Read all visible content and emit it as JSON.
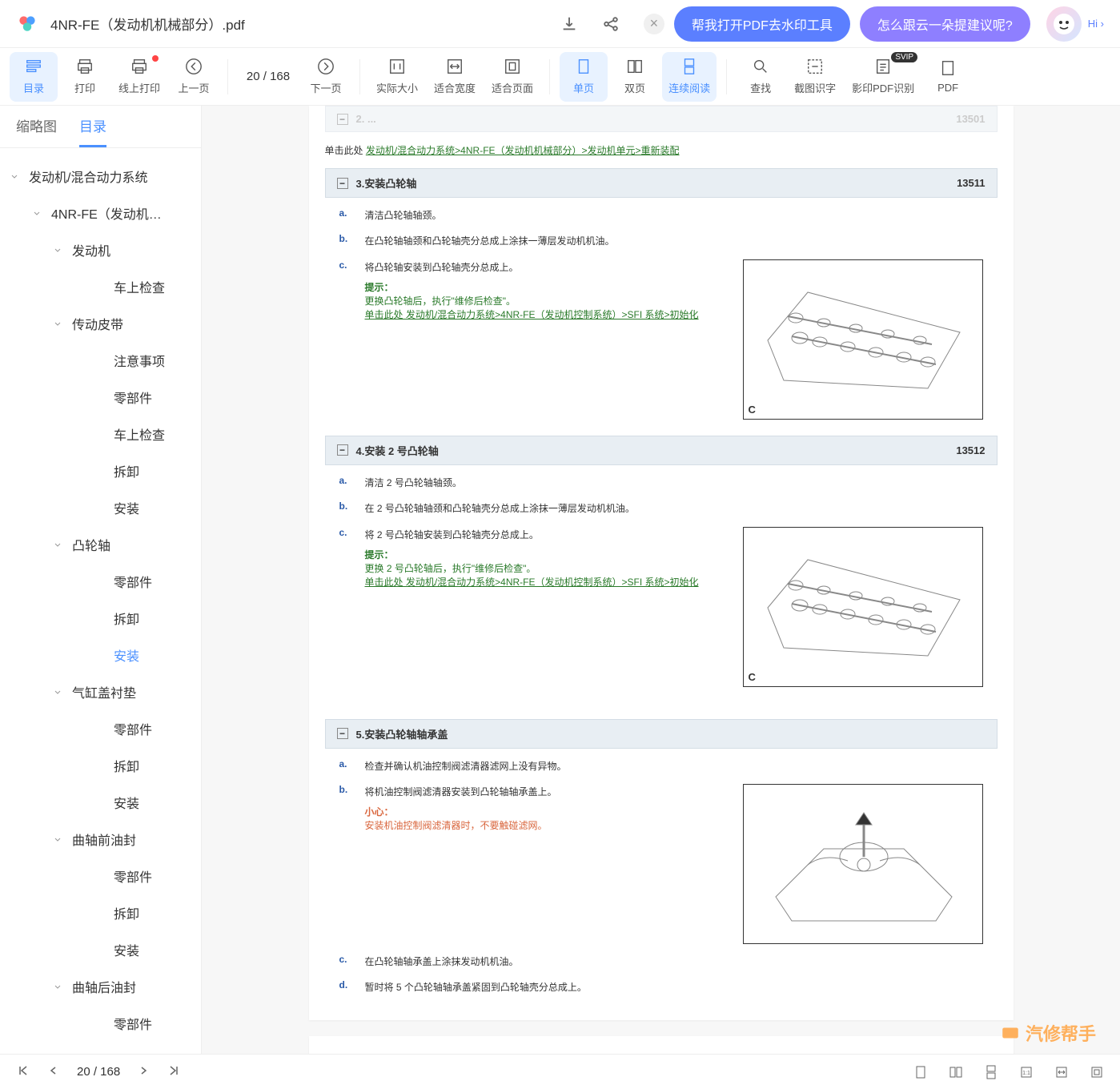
{
  "header": {
    "title": "4NR-FE（发动机机械部分）.pdf",
    "pill1": "帮我打开PDF去水印工具",
    "pill2": "怎么跟云一朵提建议呢?",
    "hi": "Hi ›"
  },
  "toolbar": {
    "items": [
      {
        "label": "目录",
        "active": true
      },
      {
        "label": "打印"
      },
      {
        "label": "线上打印",
        "dot": true
      },
      {
        "label": "上一页"
      },
      {
        "label": "",
        "page": "20 / 168"
      },
      {
        "label": "下一页"
      },
      {
        "label": "实际大小"
      },
      {
        "label": "适合宽度"
      },
      {
        "label": "适合页面"
      },
      {
        "label": "单页",
        "active": true
      },
      {
        "label": "双页"
      },
      {
        "label": "连续阅读",
        "active": true
      },
      {
        "label": "查找"
      },
      {
        "label": "截图识字"
      },
      {
        "label": "影印PDF识别",
        "svip": true
      },
      {
        "label": "PDF"
      }
    ]
  },
  "sidebar": {
    "tabs": [
      {
        "label": "缩略图"
      },
      {
        "label": "目录",
        "active": true
      }
    ],
    "items": [
      {
        "l": 0,
        "t": "发动机/混合动力系统",
        "c": 1
      },
      {
        "l": 1,
        "t": "4NR-FE（发动机…",
        "c": 1
      },
      {
        "l": 2,
        "t": "发动机",
        "c": 1
      },
      {
        "l": 3,
        "t": "车上检查"
      },
      {
        "l": 2,
        "t": "传动皮带",
        "c": 1
      },
      {
        "l": 3,
        "t": "注意事项"
      },
      {
        "l": 3,
        "t": "零部件"
      },
      {
        "l": 3,
        "t": "车上检查"
      },
      {
        "l": 3,
        "t": "拆卸"
      },
      {
        "l": 3,
        "t": "安装"
      },
      {
        "l": 2,
        "t": "凸轮轴",
        "c": 1
      },
      {
        "l": 3,
        "t": "零部件"
      },
      {
        "l": 3,
        "t": "拆卸"
      },
      {
        "l": 3,
        "t": "安装",
        "sel": 1
      },
      {
        "l": 2,
        "t": "气缸盖衬垫",
        "c": 1
      },
      {
        "l": 3,
        "t": "零部件"
      },
      {
        "l": 3,
        "t": "拆卸"
      },
      {
        "l": 3,
        "t": "安装"
      },
      {
        "l": 2,
        "t": "曲轴前油封",
        "c": 1
      },
      {
        "l": 3,
        "t": "零部件"
      },
      {
        "l": 3,
        "t": "拆卸"
      },
      {
        "l": 3,
        "t": "安装"
      },
      {
        "l": 2,
        "t": "曲轴后油封",
        "c": 1
      },
      {
        "l": 3,
        "t": "零部件"
      }
    ]
  },
  "doc": {
    "linkRow": {
      "prefix": "单击此处 ",
      "link": "发动机/混合动力系统>4NR-FE（发动机机械部分）>发动机单元>重新装配"
    },
    "sec3": {
      "title": "3.安装凸轮轴",
      "num": "13511",
      "steps": [
        {
          "l": "a.",
          "t": "清洁凸轮轴轴颈。"
        },
        {
          "l": "b.",
          "t": "在凸轮轴轴颈和凸轮轴壳分总成上涂抹一薄层发动机机油。"
        },
        {
          "l": "c.",
          "t": "将凸轮轴安装到凸轮轴壳分总成上。",
          "hint": "提示：",
          "ht": "更换凸轮轴后，执行\"维修后检查\"。",
          "hl": "单击此处 发动机/混合动力系统>4NR-FE（发动机控制系统）>SFI 系统>初始化",
          "img": 1
        }
      ]
    },
    "sec4": {
      "title": "4.安装 2 号凸轮轴",
      "num": "13512",
      "steps": [
        {
          "l": "a.",
          "t": "清洁 2 号凸轮轴轴颈。"
        },
        {
          "l": "b.",
          "t": "在 2 号凸轮轴轴颈和凸轮轴壳分总成上涂抹一薄层发动机机油。"
        },
        {
          "l": "c.",
          "t": "将 2 号凸轮轴安装到凸轮轴壳分总成上。",
          "pre": "提示：",
          "hint": "提示：",
          "ht": "更换 2 号凸轮轴后，执行\"维修后检查\"。",
          "hl": "单击此处 发动机/混合动力系统>4NR-FE（发动机控制系统）>SFI 系统>初始化",
          "img": 1
        }
      ]
    },
    "sec5": {
      "title": "5.安装凸轮轴轴承盖",
      "steps": [
        {
          "l": "a.",
          "t": "检查并确认机油控制阀滤清器滤网上没有异物。"
        },
        {
          "l": "b.",
          "t": "将机油控制阀滤清器安装到凸轮轴轴承盖上。",
          "warn": "小心：",
          "wt": "安装机油控制阀滤清器时，不要触碰滤网。",
          "img": 2
        },
        {
          "l": "c.",
          "t": "在凸轮轴轴承盖上涂抹发动机机油。"
        },
        {
          "l": "d.",
          "t": "暂时将 5 个凸轮轴轴承盖紧固到凸轮轴壳分总成上。"
        }
      ]
    }
  },
  "footer": {
    "page": "20 / 168",
    "watermark": "汽修帮手"
  }
}
